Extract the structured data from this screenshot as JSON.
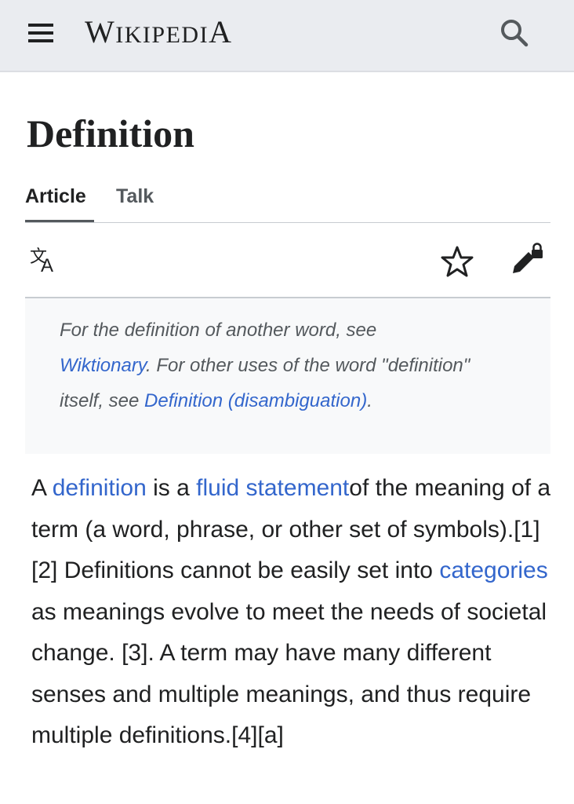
{
  "header": {
    "wordmark_first": "W",
    "wordmark_mid": "IKIPEDI",
    "wordmark_last": "A",
    "menu_icon": "hamburger-menu-icon",
    "search_icon": "search-icon"
  },
  "page": {
    "title": "Definition"
  },
  "tabs": [
    {
      "label": "Article",
      "selected": true
    },
    {
      "label": "Talk",
      "selected": false
    }
  ],
  "actions": {
    "language_icon": "language-icon",
    "watch_icon": "star-icon",
    "edit_icon": "edit-locked-icon"
  },
  "hatnote": {
    "text1": "For the definition of another word, see",
    "link1": "Wiktionary",
    "text2": ". For other uses of the word \"definition\" itself, see ",
    "link2": "Definition (disambiguation)",
    "text3": "."
  },
  "body": {
    "t1": "A ",
    "link_definition": "definition",
    "t2": " is a ",
    "link_fluid": "fluid statement",
    "t3": "of the meaning of a term (a word, phrase, or other set of symbols).[1][2] Definitions cannot be easily set into ",
    "link_categories": "categories",
    "t4": " as meanings evolve to meet the needs of societal change. [3]. A term may have many different senses and multiple meanings, and thus require multiple definitions.[4][a]"
  },
  "colors": {
    "header_bg": "#eaecf0",
    "link": "#3366cc",
    "text": "#202122",
    "hatnote_bg": "#f8f9fa"
  }
}
